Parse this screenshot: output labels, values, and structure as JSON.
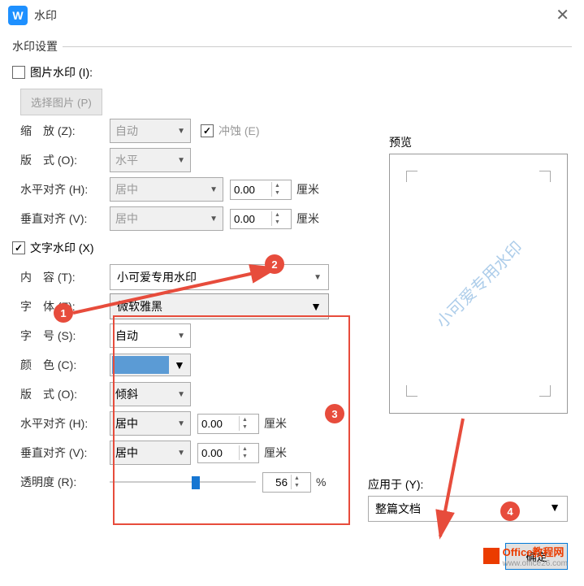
{
  "title": "水印",
  "section_title": "水印设置",
  "image_watermark": {
    "label": "图片水印 (I):",
    "checked": false,
    "select_button": "选择图片 (P)",
    "scale_label": "缩　放 (Z):",
    "scale_value": "自动",
    "washout_label": "冲蚀 (E)",
    "layout_label": "版　式 (O):",
    "layout_value": "水平",
    "halign_label": "水平对齐 (H):",
    "halign_value": "居中",
    "halign_offset": "0.00",
    "valign_label": "垂直对齐 (V):",
    "valign_value": "居中",
    "valign_offset": "0.00",
    "unit": "厘米"
  },
  "text_watermark": {
    "label": "文字水印 (X)",
    "checked": true,
    "content_label": "内　容 (T):",
    "content_value": "小可爱专用水印",
    "font_label": "字　体 (F):",
    "font_value": "微软雅黑",
    "size_label": "字　号 (S):",
    "size_value": "自动",
    "color_label": "颜　色 (C):",
    "color_value": "#5b9bd5",
    "layout_label": "版　式 (O):",
    "layout_value": "倾斜",
    "halign_label": "水平对齐 (H):",
    "halign_value": "居中",
    "halign_offset": "0.00",
    "valign_label": "垂直对齐 (V):",
    "valign_value": "居中",
    "valign_offset": "0.00",
    "unit": "厘米",
    "opacity_label": "透明度 (R):",
    "opacity_value": "56",
    "opacity_unit": "%"
  },
  "preview": {
    "label": "预览",
    "text": "小可爱专用水印"
  },
  "apply": {
    "label": "应用于 (Y):",
    "value": "整篇文档"
  },
  "buttons": {
    "ok": "确定"
  },
  "branding": {
    "name": "Office教程网",
    "url": "www.office26.com"
  },
  "annotations": [
    "1",
    "2",
    "3",
    "4"
  ]
}
